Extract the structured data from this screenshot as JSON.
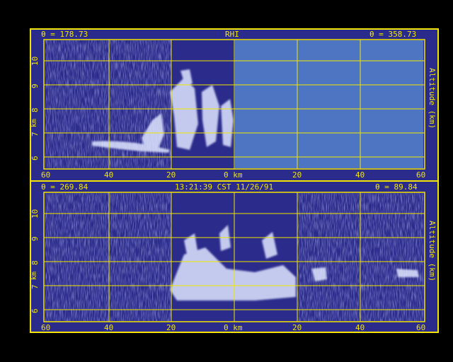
{
  "colors": {
    "frame": "#f2e600",
    "background": "#2b2b8c",
    "noise": "#3a3aa0",
    "echo": "#dfe6ff",
    "blank_sector": "#4d75c2"
  },
  "top_panel": {
    "left_angle": "θ = 178.73",
    "title": "RHI",
    "right_angle": "θ = 358.73",
    "y_unit": "km",
    "right_label": "Altitude (km)"
  },
  "bottom_panel": {
    "left_angle": "θ = 269.84",
    "title": "13:21:39 CST 11/26/91",
    "right_angle": "θ = 89.84",
    "y_unit": "km",
    "right_label": "Altitude (km)"
  },
  "axis": {
    "x_ticks": [
      "60",
      "40",
      "20",
      "0 km",
      "20",
      "40",
      "60"
    ],
    "y_ticks": [
      "10",
      "9",
      "8",
      "7",
      "6"
    ]
  }
}
